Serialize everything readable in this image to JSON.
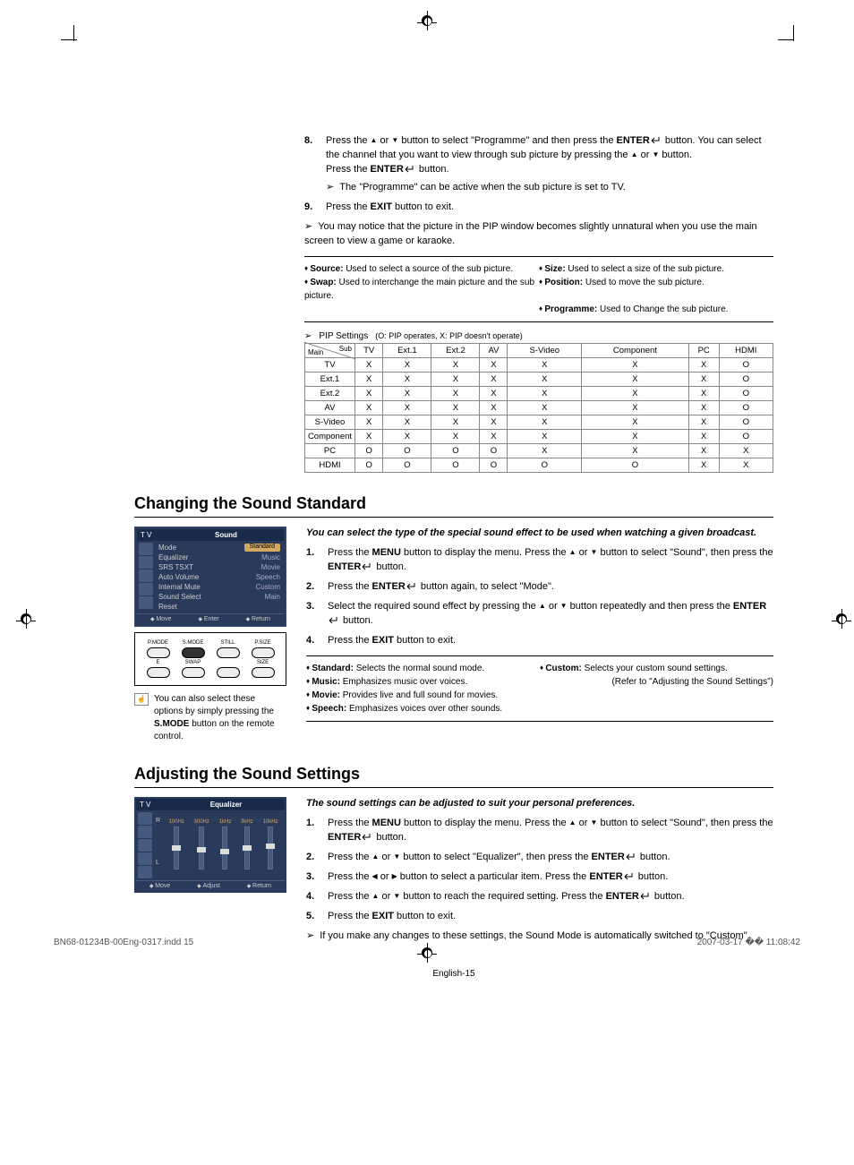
{
  "step8": {
    "num": "8.",
    "text1": "Press the ",
    "text2": " or ",
    "text3": " button to select \"Programme\" and then press the ",
    "enter": "ENTER",
    "text4": " button. You can select the channel that you want to view through sub picture by pressing the ",
    "text5": " or ",
    "text6": " button.",
    "text7": "Press the ",
    "text8": " button.",
    "note": "The \"Programme\" can be active when the sub picture is set to TV."
  },
  "step9": {
    "num": "9.",
    "text1": "Press the ",
    "exit": "EXIT",
    "text2": " button to exit."
  },
  "pip_note": "You may notice that the picture in the PIP window becomes slightly unnatural when you use the main screen to view a game or karaoke.",
  "info_items": {
    "source_lbl": "Source:",
    "source_txt": " Used to select a source of the sub picture.",
    "swap_lbl": "Swap:",
    "swap_txt": " Used to interchange the main picture and the sub picture.",
    "size_lbl": "Size:",
    "size_txt": " Used to select a size of the sub picture.",
    "position_lbl": "Position:",
    "position_txt": " Used to move the sub picture.",
    "programme_lbl": "Programme:",
    "programme_txt": " Used to Change the sub picture."
  },
  "pip_settings": {
    "title": "PIP Settings",
    "legend": "(O: PIP operates, X: PIP doesn't operate)",
    "main": "Main",
    "sub": "Sub",
    "headers": [
      "TV",
      "Ext.1",
      "Ext.2",
      "AV",
      "S-Video",
      "Component",
      "PC",
      "HDMI"
    ],
    "rows": [
      {
        "label": "TV",
        "cells": [
          "X",
          "X",
          "X",
          "X",
          "X",
          "X",
          "X",
          "O"
        ]
      },
      {
        "label": "Ext.1",
        "cells": [
          "X",
          "X",
          "X",
          "X",
          "X",
          "X",
          "X",
          "O"
        ]
      },
      {
        "label": "Ext.2",
        "cells": [
          "X",
          "X",
          "X",
          "X",
          "X",
          "X",
          "X",
          "O"
        ]
      },
      {
        "label": "AV",
        "cells": [
          "X",
          "X",
          "X",
          "X",
          "X",
          "X",
          "X",
          "O"
        ]
      },
      {
        "label": "S-Video",
        "cells": [
          "X",
          "X",
          "X",
          "X",
          "X",
          "X",
          "X",
          "O"
        ]
      },
      {
        "label": "Component",
        "cells": [
          "X",
          "X",
          "X",
          "X",
          "X",
          "X",
          "X",
          "O"
        ]
      },
      {
        "label": "PC",
        "cells": [
          "O",
          "O",
          "O",
          "O",
          "X",
          "X",
          "X",
          "X"
        ]
      },
      {
        "label": "HDMI",
        "cells": [
          "O",
          "O",
          "O",
          "O",
          "O",
          "O",
          "X",
          "X"
        ]
      }
    ]
  },
  "sound_section": {
    "title": "Changing the Sound Standard",
    "intro": "You can select the type of the special sound effect to be used when watching a given broadcast.",
    "steps": [
      {
        "num": "1.",
        "parts": [
          "Press the ",
          "MENU",
          " button to display the menu. Press the ",
          " or ",
          " button to select \"Sound\", then press the ",
          "ENTER",
          " button."
        ]
      },
      {
        "num": "2.",
        "parts": [
          "Press the ",
          "ENTER",
          " button again, to select \"Mode\"."
        ]
      },
      {
        "num": "3.",
        "parts": [
          "Select the required sound effect by pressing the ",
          " or ",
          " button repeatedly and then press the ",
          "ENTER",
          " button."
        ]
      },
      {
        "num": "4.",
        "parts": [
          "Press the ",
          "EXIT",
          " button to exit."
        ]
      }
    ]
  },
  "sound_osd": {
    "tv": "T V",
    "title": "Sound",
    "rows": [
      {
        "lbl": "Mode",
        "val": "Standard",
        "hl": true
      },
      {
        "lbl": "Equalizer",
        "val": "Music"
      },
      {
        "lbl": "SRS TSXT",
        "val": "Movie"
      },
      {
        "lbl": "Auto Volume",
        "val": "Speech"
      },
      {
        "lbl": "Internal Mute",
        "val": "Custom"
      },
      {
        "lbl": "Sound Select",
        "val": "Main"
      },
      {
        "lbl": "Reset",
        "val": ""
      }
    ],
    "footer": [
      "Move",
      "Enter",
      "Return"
    ]
  },
  "remote_labels": [
    "P.MODE",
    "S.MODE",
    "STILL",
    "P.SIZE",
    "E",
    "SWAP",
    "SIZE"
  ],
  "tip_text1": "You can also select these options by simply pressing the ",
  "tip_bold": "S.MODE",
  "tip_text2": " button on the remote control.",
  "sound_modes": [
    {
      "lbl": "Standard:",
      "txt": " Selects the normal sound mode."
    },
    {
      "lbl": "Music:",
      "txt": " Emphasizes music over voices."
    },
    {
      "lbl": "Movie:",
      "txt": " Provides live and full sound for movies."
    },
    {
      "lbl": "Speech:",
      "txt": " Emphasizes voices over other sounds."
    },
    {
      "lbl": "Custom:",
      "txt": " Selects your custom sound settings."
    }
  ],
  "sound_ref": "(Refer to \"Adjusting the Sound Settings\")",
  "adjust_section": {
    "title": "Adjusting the Sound Settings",
    "intro": "The sound settings can be adjusted to suit your personal preferences.",
    "steps": [
      {
        "num": "1.",
        "parts": [
          "Press the ",
          "MENU",
          " button to display the menu. Press the ",
          " or ",
          " button to select \"Sound\", then press the ",
          "ENTER",
          " button."
        ]
      },
      {
        "num": "2.",
        "parts": [
          "Press the ",
          " or ",
          " button to select \"Equalizer\", then press the ",
          "ENTER",
          " button."
        ]
      },
      {
        "num": "3.",
        "parts": [
          "Press the ",
          " or ",
          " button to select a particular item. Press the ",
          "ENTER",
          " button."
        ]
      },
      {
        "num": "4.",
        "parts": [
          "Press the ",
          " or ",
          " button to reach the required setting. Press the ",
          "ENTER",
          " button."
        ]
      },
      {
        "num": "5.",
        "parts": [
          "Press the ",
          "EXIT",
          " button to exit."
        ]
      }
    ],
    "note": "If you make any changes to these settings, the Sound Mode is automatically switched to \"Custom\"."
  },
  "eq_osd": {
    "tv": "T V",
    "title": "Equalizer",
    "r": "R",
    "l": "L",
    "freqs": [
      "100Hz",
      "300Hz",
      "1kHz",
      "3kHz",
      "10kHz"
    ],
    "footer": [
      "Move",
      "Adjust",
      "Return"
    ]
  },
  "page_num": "English-15",
  "footer_left": "BN68-01234B-00Eng-0317.indd   15",
  "footer_right": "2007-03-17   �� 11:08:42"
}
